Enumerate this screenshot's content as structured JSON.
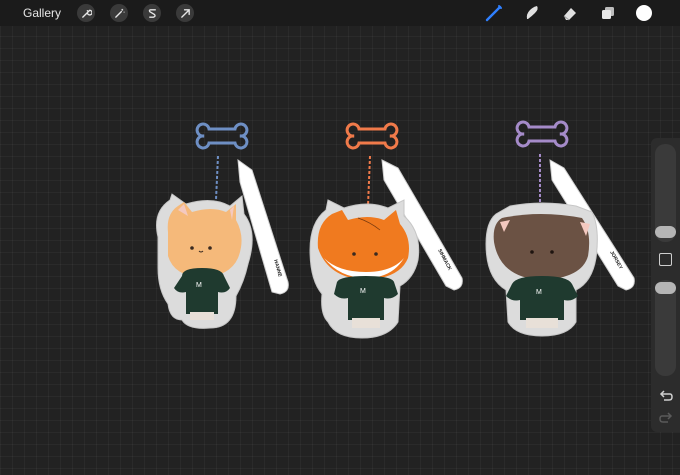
{
  "topbar": {
    "gallery_label": "Gallery",
    "left_tools": [
      "wrench-icon",
      "magic-wand-icon",
      "selection-s-icon",
      "transform-arrow-icon"
    ],
    "right_tools": [
      "brush-icon",
      "smudge-icon",
      "eraser-icon",
      "layers-icon"
    ],
    "active_color": "#ffffff",
    "brush_color": "#2f80ff"
  },
  "artwork": {
    "keychains": [
      {
        "name": "cream-cat-keychain",
        "bone_color": "#6e8fc4",
        "strap_text": "HANNE"
      },
      {
        "name": "orange-fox-keychain",
        "bone_color": "#f07a4a",
        "strap_text": "SIHMACK"
      },
      {
        "name": "brown-cat-keychain",
        "bone_color": "#a58bc9",
        "strap_text": "JORSEY"
      }
    ]
  },
  "sidebar": {
    "brush_size": 0.65,
    "opacity": 0.9,
    "icons": [
      "modify-square-icon",
      "undo-icon",
      "redo-icon"
    ]
  }
}
